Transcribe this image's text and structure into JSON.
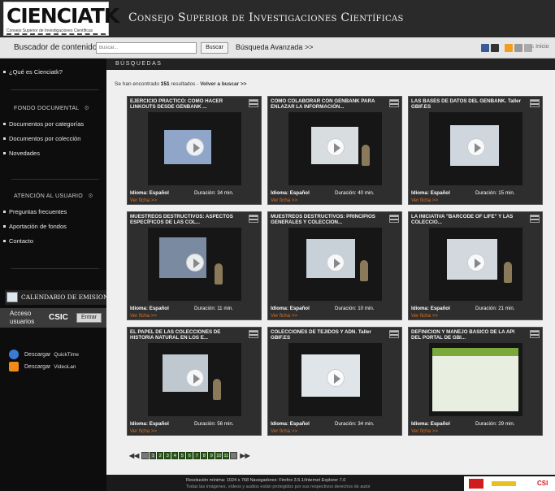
{
  "header": {
    "logo_text": "CIENCIATK",
    "logo_subtitle": "Consejo Superior de Investigaciones Científicas",
    "title": "Consejo Superior de Investigaciones Científicas"
  },
  "searchbar": {
    "label": "Buscador de contenidos",
    "placeholder": "Buscar...",
    "button": "Buscar",
    "advanced": "Búsqueda Avanzada >>",
    "inicio": "⌂ Inicio"
  },
  "sidebar": {
    "about": "¿Qué es Cienciatk?",
    "fondo_title": "FONDO DOCUMENTAL",
    "fondo_items": [
      "Documentos por categorías",
      "Documentos por colección",
      "Novedades"
    ],
    "atencion_title": "ATENCIÓN AL USUARIO",
    "atencion_items": [
      "Preguntas frecuentes",
      "Aportación de fondos",
      "Contacto"
    ],
    "calendar": "CALENDARIO DE EMISIONES",
    "access_label": "Acceso usuarios",
    "access_csic": "CSIC",
    "access_button": "Entrar",
    "downloads": [
      {
        "label": "Descargar",
        "app": "QuickTime",
        "color": "#3a7bd5"
      },
      {
        "label": "Descargar",
        "app": "VideoLan",
        "color": "#f08a1c"
      }
    ]
  },
  "main": {
    "section_title": "BÚSQUEDAS",
    "results_prefix": "Se han encontrado",
    "results_count": "151",
    "results_suffix": "resultados -",
    "back_link": "Volver a buscar >>",
    "cards": [
      {
        "title": "EJERCICIO PRÁCTICO: CÓMO HACER LINKOUTS DESDE GENBANK ...",
        "idioma": "Idioma: Español",
        "duracion": "Duración: 34 min.",
        "ficha": "Ver ficha >>"
      },
      {
        "title": "CÓMO COLABORAR CON GENBANK PARA ENLAZAR LA INFORMACIÓN...",
        "idioma": "Idioma: Español",
        "duracion": "Duración: 40 min.",
        "ficha": "Ver ficha >>"
      },
      {
        "title": "LAS BASES DE DATOS DEL GENBANK. Taller GBIF.ES",
        "idioma": "Idioma: Español",
        "duracion": "Duración: 15 min.",
        "ficha": "Ver ficha >>"
      },
      {
        "title": "MUESTREOS DESTRUCTIVOS: ASPECTOS ESPECÍFICOS DE LAS COL...",
        "idioma": "Idioma: Español",
        "duracion": "Duración: 11 min.",
        "ficha": "Ver ficha >>"
      },
      {
        "title": "MUESTREOS DESTRUCTIVOS: PRINCIPIOS GENERALES Y COLECCION...",
        "idioma": "Idioma: Español",
        "duracion": "Duración: 10 min.",
        "ficha": "Ver ficha >>"
      },
      {
        "title": "LA INICIATIVA \"BARCODE OF LIFE\" Y LAS COLECCIO...",
        "idioma": "Idioma: Español",
        "duracion": "Duración: 21 min.",
        "ficha": "Ver ficha >>"
      },
      {
        "title": "EL PAPEL DE LAS COLECCIONES DE HISTORIA NATURAL EN LOS E...",
        "idioma": "Idioma: Español",
        "duracion": "Duración: 56 min.",
        "ficha": "Ver ficha >>"
      },
      {
        "title": "COLECCIONES DE TEJIDOS Y ADN. Taller GBIF.ES",
        "idioma": "Idioma: Español",
        "duracion": "Duración: 34 min.",
        "ficha": "Ver ficha >>"
      },
      {
        "title": "DEFINICIÓN Y MANEJO BÁSICO DE LA API DEL PORTAL DE GBI...",
        "idioma": "Idioma: Español",
        "duracion": "Duración: 29 min.",
        "ficha": "Ver ficha >>"
      }
    ],
    "pager": {
      "first": "◀◀",
      "last": "▶▶",
      "pages": [
        "1",
        "2",
        "3",
        "4",
        "5",
        "6",
        "7",
        "8",
        "9",
        "10",
        "11"
      ]
    }
  },
  "footer": {
    "line1": "Resolución mínima: 1024 x 768 Navegadores: Firefox 3.5.1/Internet Explorer 7.0",
    "line2": "Todas las imágenes, vídeos y audios están protegidos por sus respectivos derechos de autor",
    "csic": "CSI"
  }
}
